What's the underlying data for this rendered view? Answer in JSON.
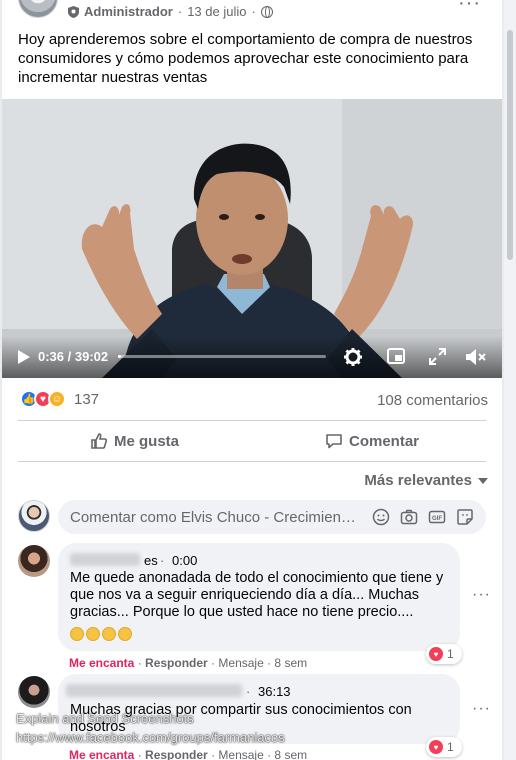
{
  "post": {
    "author_role": "Administrador",
    "date": "13 de julio",
    "text": "Hoy aprenderemos sobre el comportamiento de compra de nuestros consumidores y cómo podemos aprovechar este conocimiento para incrementar nuestras ventas",
    "more_icon": "more-horizontal-icon"
  },
  "video": {
    "time": "0:36 / 39:02",
    "progress": 0.015,
    "icons": [
      "play-icon",
      "settings-icon",
      "picture-in-picture-icon",
      "fullscreen-icon",
      "volume-muted-icon"
    ]
  },
  "stats": {
    "reaction_count": "137",
    "comments": "108 comentarios",
    "reaction_icons": [
      "like-reaction-icon",
      "love-reaction-icon",
      "care-reaction-icon"
    ]
  },
  "actions": {
    "like": "Me gusta",
    "comment": "Comentar"
  },
  "sort": {
    "label": "Más relevantes"
  },
  "composer": {
    "placeholder": "Comentar como Elvis Chuco - Crecimiento..."
  },
  "comments": [
    {
      "name_tail": "es",
      "time": "0:00",
      "text": "Me quede anonadada de todo el conocimiento que tiene y que nos va a seguir enriqueciendo día a día... Muchas gracias... Porque lo que usted hace no tiene precio....",
      "love": "Me encanta",
      "reply": "Responder",
      "meta": "· Mensaje · 8 sem",
      "reaction_count": "1"
    },
    {
      "time": "36:13",
      "text": "Muchas gracias por compartir sus conocimientos con nosotros",
      "love": "Me encanta",
      "reply": "Responder",
      "meta": "· Mensaje · 8 sem",
      "reaction_count": "1"
    }
  ],
  "watermark": {
    "line1": "Explain and Send Screenshots",
    "line2": "https://www.facebook.com/groups/farmaniacos"
  },
  "colors": {
    "accent": "#1877f2",
    "love": "#f33e58",
    "text_secondary": "#65676b"
  }
}
